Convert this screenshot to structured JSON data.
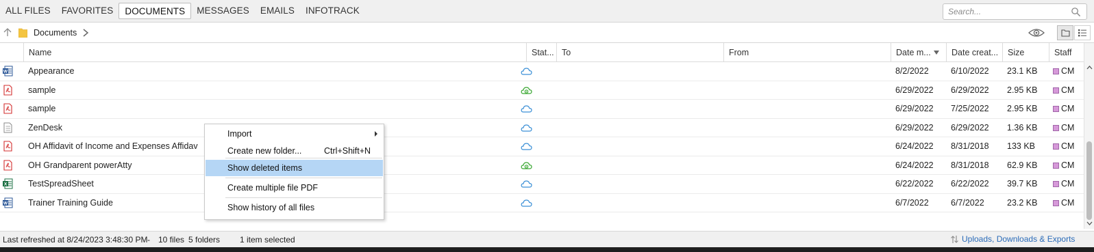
{
  "tabs": [
    {
      "label": "ALL FILES",
      "active": false
    },
    {
      "label": "FAVORITES",
      "active": false
    },
    {
      "label": "DOCUMENTS",
      "active": true
    },
    {
      "label": "MESSAGES",
      "active": false
    },
    {
      "label": "EMAILS",
      "active": false
    },
    {
      "label": "INFOTRACK",
      "active": false
    }
  ],
  "search": {
    "placeholder": "Search...",
    "icon": "search-icon"
  },
  "breadcrumb": {
    "label": "Documents"
  },
  "columns": {
    "name": "Name",
    "status": "Stat...",
    "to": "To",
    "from": "From",
    "date_modified": "Date m...",
    "date_created": "Date creat...",
    "size": "Size",
    "staff": "Staff"
  },
  "rows": [
    {
      "icon": "word-doc-icon",
      "name": "Appearance",
      "status": "cloud",
      "to": "",
      "from": "",
      "date_modified": "8/2/2022",
      "date_created": "6/10/2022",
      "size": "23.1 KB",
      "staff": "CM"
    },
    {
      "icon": "pdf-icon",
      "name": "sample",
      "status": "cloud-synced",
      "to": "",
      "from": "",
      "date_modified": "6/29/2022",
      "date_created": "6/29/2022",
      "size": "2.95 KB",
      "staff": "CM"
    },
    {
      "icon": "pdf-icon",
      "name": "sample",
      "status": "cloud",
      "to": "",
      "from": "",
      "date_modified": "6/29/2022",
      "date_created": "7/25/2022",
      "size": "2.95 KB",
      "staff": "CM"
    },
    {
      "icon": "text-file-icon",
      "name": "ZenDesk",
      "status": "cloud",
      "to": "",
      "from": "",
      "date_modified": "6/29/2022",
      "date_created": "6/29/2022",
      "size": "1.36 KB",
      "staff": "CM"
    },
    {
      "icon": "pdf-icon",
      "name": "OH Affidavit of Income and Expenses Affidav",
      "status": "cloud",
      "to": "",
      "from": "",
      "date_modified": "6/24/2022",
      "date_created": "8/31/2018",
      "size": "133 KB",
      "staff": "CM"
    },
    {
      "icon": "pdf-icon",
      "name": "OH Grandparent powerAtty",
      "status": "cloud-synced",
      "to": "",
      "from": "",
      "date_modified": "6/24/2022",
      "date_created": "8/31/2018",
      "size": "62.9 KB",
      "staff": "CM"
    },
    {
      "icon": "excel-icon",
      "name": "TestSpreadSheet",
      "status": "cloud",
      "to": "",
      "from": "",
      "date_modified": "6/22/2022",
      "date_created": "6/22/2022",
      "size": "39.7 KB",
      "staff": "CM"
    },
    {
      "icon": "word-doc-icon",
      "name": "Trainer Training Guide",
      "status": "cloud",
      "to": "",
      "from": "",
      "date_modified": "6/7/2022",
      "date_created": "6/7/2022",
      "size": "23.2 KB",
      "staff": "CM"
    }
  ],
  "context_menu": {
    "items": [
      {
        "label": "Import",
        "shortcut": "",
        "submenu": true,
        "highlighted": false
      },
      {
        "label": "Create new folder...",
        "shortcut": "Ctrl+Shift+N",
        "submenu": false,
        "highlighted": false
      },
      {
        "label": "Show deleted items",
        "shortcut": "",
        "submenu": false,
        "highlighted": true
      },
      {
        "label": "Create multiple file PDF",
        "shortcut": "",
        "submenu": false,
        "highlighted": false
      },
      {
        "label": "Show history of all files",
        "shortcut": "",
        "submenu": false,
        "highlighted": false
      }
    ]
  },
  "status_bar": {
    "last_refreshed": "Last refreshed at 8/24/2023 3:48:30 PM",
    "separator": "-",
    "files": "10 files",
    "folders": "5 folders",
    "selected": "1 item selected",
    "uploads_link": "Uploads, Downloads & Exports"
  },
  "colors": {
    "accent": "#2a6bb8",
    "cloud_blue": "#3a8fd6",
    "cloud_green": "#3aa832",
    "menu_highlight": "#b5d6f5",
    "staff_marker": "#d699d9"
  }
}
